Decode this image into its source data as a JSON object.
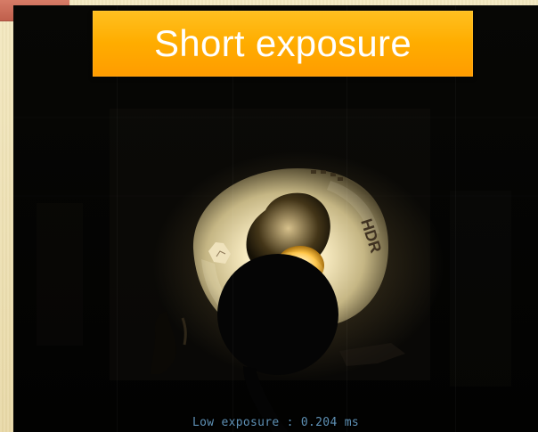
{
  "slide": {
    "title": "Short exposure",
    "caption": "Low exposure : 0.204 ms",
    "lamp_label": "HDR"
  },
  "colors": {
    "banner": "#ffb000",
    "caption": "#5e90b4",
    "corner_tab": "#cf6d58"
  }
}
